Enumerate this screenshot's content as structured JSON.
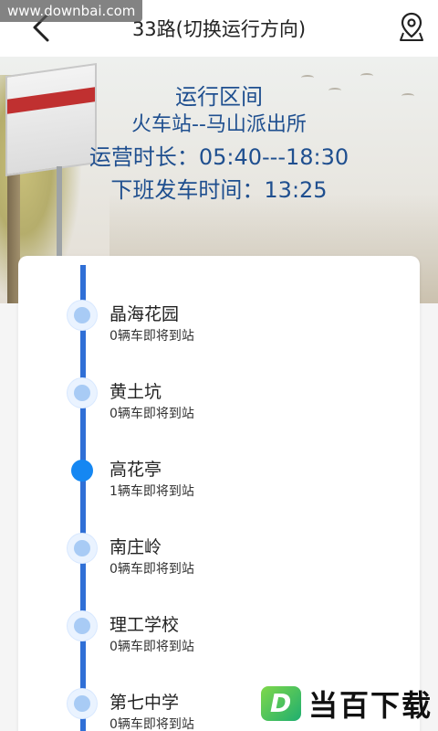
{
  "header": {
    "title": "33路(切换运行方向)",
    "watermark": "www.downbai.com"
  },
  "banner": {
    "line1": "运行区间",
    "line2": "火车站--马山派出所",
    "line3": "运营时长：05:40---18:30",
    "line4": "下班发车时间：13:25"
  },
  "stops": [
    {
      "name": "晶海花园",
      "status": "0辆车即将到站",
      "active": false
    },
    {
      "name": "黄土坑",
      "status": "0辆车即将到站",
      "active": false
    },
    {
      "name": "高花亭",
      "status": "1辆车即将到站",
      "active": true
    },
    {
      "name": "南庄岭",
      "status": "0辆车即将到站",
      "active": false
    },
    {
      "name": "理工学校",
      "status": "0辆车即将到站",
      "active": false
    },
    {
      "name": "第七中学",
      "status": "0辆车即将到站",
      "active": false
    }
  ],
  "brand": {
    "badge": "D",
    "text": "当百下载"
  },
  "colors": {
    "line": "#2f6fd6",
    "active_dot": "#1587f2",
    "banner_text": "#1f4f8f"
  },
  "icons": [
    "back-arrow-icon",
    "location-pin-icon"
  ]
}
